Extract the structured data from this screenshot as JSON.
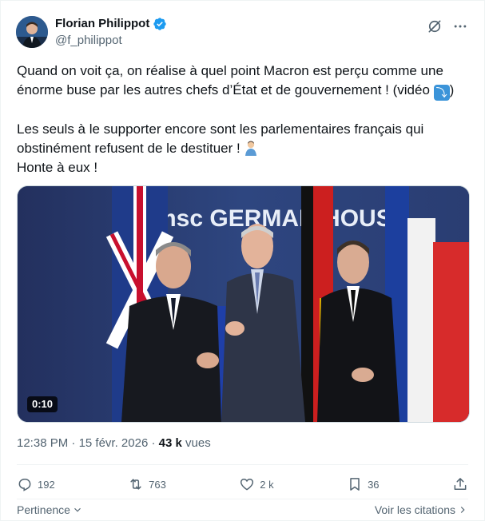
{
  "author": {
    "name": "Florian Philippot",
    "handle": "@f_philippot",
    "verified_color": "#1d9bf0",
    "avatar_icon": "avatar-portrait"
  },
  "header_icons": [
    "grok-icon",
    "more-icon"
  ],
  "tweet": {
    "line1": "Quand on voit ça, on réalise à quel point Macron est perçu comme une",
    "line2_text": "énorme buse par les autres chefs d’État et de gouvernement ! (vidéo ",
    "line2_emoji": "⤵",
    "line2_end": ")",
    "line3": "Les seuls à le supporter encore sont les parlementaires français qui",
    "line4_text": "obstinément refusent de le destituer ! ",
    "line5": "Honte à eux !"
  },
  "media": {
    "type": "video",
    "duration": "0:10",
    "backdrop_text": "msc GERMAN HOUSE"
  },
  "meta": {
    "time": "12:38 PM",
    "separator": " · ",
    "date": "15 févr. 2026",
    "views_count": "43 k",
    "views_label": " vues"
  },
  "actions": {
    "replies": "192",
    "reposts": "763",
    "likes": "2 k",
    "bookmarks": "36"
  },
  "footer": {
    "sort_label": "Pertinence",
    "quotes_label": "Voir les citations"
  },
  "colors": {
    "text": "#0f1419",
    "secondary": "#536471",
    "accent": "#1d9bf0"
  }
}
